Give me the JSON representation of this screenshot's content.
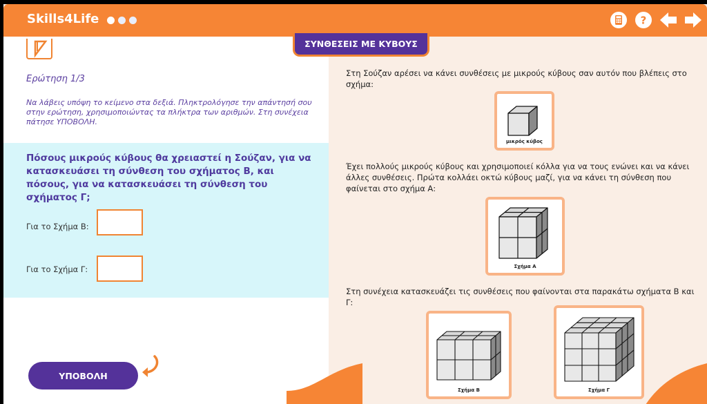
{
  "header": {
    "brand": "Skills4Life",
    "icons": [
      "calculator-icon",
      "help-icon",
      "arrow-left-icon",
      "arrow-right-icon"
    ],
    "accent_color": "#f68535"
  },
  "title": "ΣΥΝΘΕΣΕΙΣ ΜΕ ΚΥΒΟΥΣ",
  "left": {
    "question_label": "Ερώτηση 1/3",
    "instructions": "Να λάβεις υπόψη το κείμενο στα δεξιά. Πληκτρολόγησε την απάντησή σου στην ερώτηση, χρησιμοποιώντας τα πλήκτρα των αριθμών. Στη συνέχεια πάτησε ΥΠΟΒΟΛΗ.",
    "question": "Πόσους μικρούς κύβους θα χρειαστεί η Σούζαν, για να κατασκευάσει τη σύνθεση του σχήματος Β, και πόσους, για να κατασκευάσει τη σύνθεση του σχήματος Γ;",
    "field_b_label": "Για το Σχήμα Β:",
    "field_b_value": "",
    "field_g_label": "Για το Σχήμα Γ:",
    "field_g_value": "",
    "submit_label": "ΥΠΟΒΟΛΗ"
  },
  "right": {
    "para1": "Στη Σούζαν αρέσει να κάνει συνθέσεις με μικρούς κύβους σαν αυτόν που βλέπεις στο σχήμα:",
    "caption_cube": "μικρός κύβος",
    "para2": "Έχει πολλούς μικρούς κύβους και χρησιμοποιεί κόλλα για να τους ενώνει και να κάνει άλλες συνθέσεις. Πρώτα κολλάει οκτώ κύβους μαζί, για να κάνει τη σύνθεση που φαίνεται στο σχήμα Α:",
    "caption_a": "Σχήμα Α",
    "para3": "Στη συνέχεια κατασκευάζει τις συνθέσεις που φαίνονται στα παρακάτω σχήματα Β και Γ:",
    "caption_b": "Σχήμα Β",
    "caption_g": "Σχήμα Γ"
  }
}
